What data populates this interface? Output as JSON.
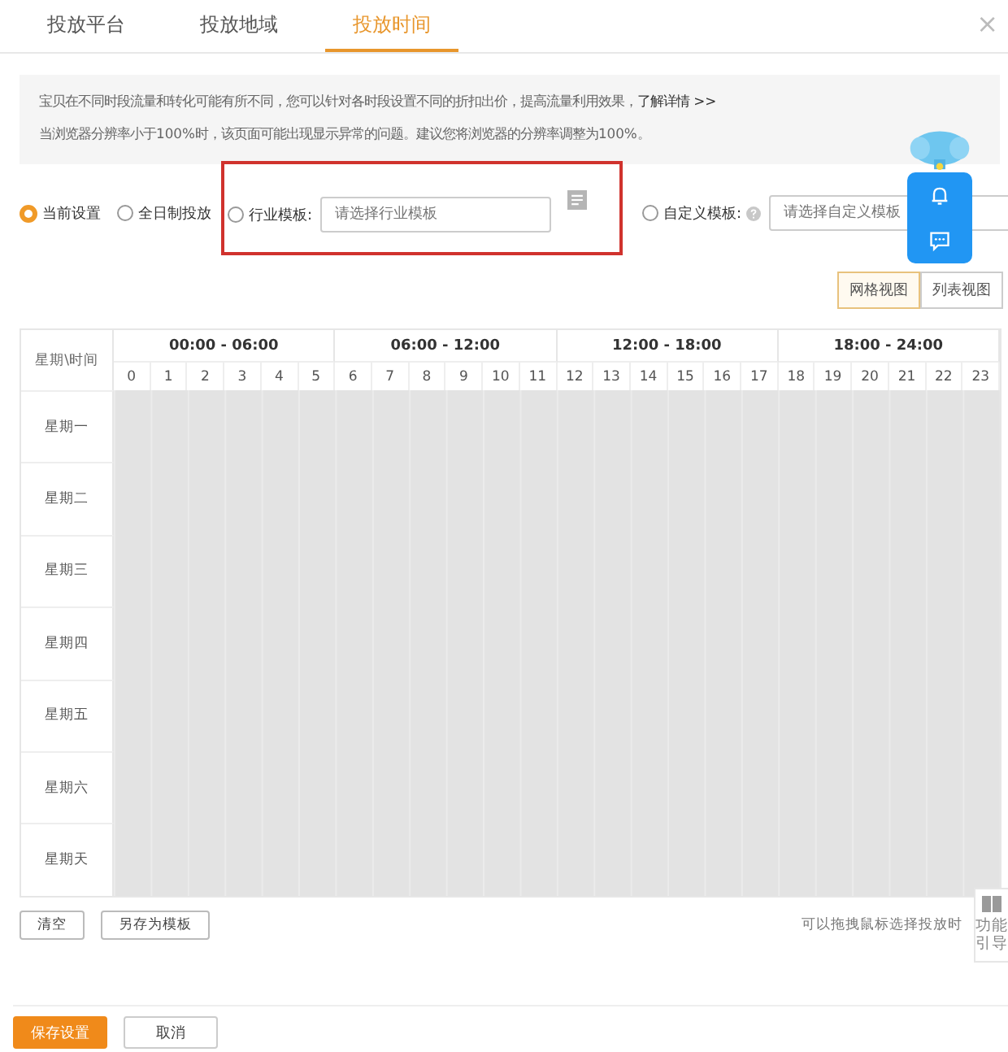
{
  "tabs": [
    {
      "label": "投放平台",
      "selected": false
    },
    {
      "label": "投放地域",
      "selected": false
    },
    {
      "label": "投放时间",
      "selected": true
    }
  ],
  "close": "×",
  "notice": {
    "line1": "宝贝在不同时段流量和转化可能有所不同，您可以针对各时段设置不同的折扣出价，提高流量利用效果，",
    "link": "了解详情 >>",
    "line2": "当浏览器分辨率小于100%时，该页面可能出现显示异常的问题。建议您将浏览器的分辨率调整为100%。"
  },
  "options": [
    {
      "kind": "radio",
      "label": "当前设置",
      "selected": true
    },
    {
      "kind": "radio",
      "label": "全日制投放",
      "selected": false
    },
    {
      "kind": "template",
      "label": "行业模板:",
      "selected": false,
      "placeholder": "请选择行业模板",
      "highlighted": true
    },
    {
      "kind": "custom",
      "label": "自定义模板:",
      "selected": false,
      "placeholder": "请选择自定义模板",
      "highlighted": false
    }
  ],
  "views": [
    {
      "label": "网格视图",
      "selected": true
    },
    {
      "label": "列表视图",
      "selected": false
    }
  ],
  "grid": {
    "corner": "星期\\时间",
    "groups": [
      "00:00 - 06:00",
      "06:00 - 12:00",
      "12:00 - 18:00",
      "18:00 - 24:00"
    ],
    "hours": [
      "0",
      "1",
      "2",
      "3",
      "4",
      "5",
      "6",
      "7",
      "8",
      "9",
      "10",
      "11",
      "12",
      "13",
      "14",
      "15",
      "16",
      "17",
      "18",
      "19",
      "20",
      "21",
      "22",
      "23"
    ],
    "days": [
      "星期一",
      "星期二",
      "星期三",
      "星期四",
      "星期五",
      "星期六",
      "星期天"
    ]
  },
  "actions": [
    "清空",
    "另存为模板"
  ],
  "hint": "可以拖拽鼠标选择投放时",
  "guide": "功能引导",
  "footer": [
    {
      "label": "保存设置",
      "primary": true
    },
    {
      "label": "取消",
      "primary": false
    }
  ]
}
